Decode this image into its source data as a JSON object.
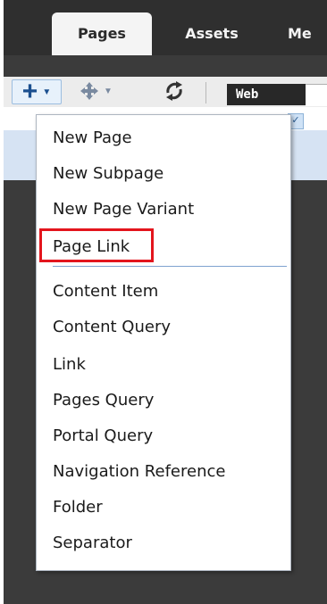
{
  "tabs": {
    "pages": "Pages",
    "assets": "Assets",
    "more": "Me"
  },
  "toolbar": {
    "add_icon": "plus-icon",
    "move_icon": "move-arrows-icon",
    "refresh_icon": "refresh-icon",
    "web_label": "Web"
  },
  "menu": {
    "items": [
      "New Page",
      "New Subpage",
      "New Page Variant",
      "Page Link",
      "Content Item",
      "Content Query",
      "Link",
      "Pages Query",
      "Portal Query",
      "Navigation Reference",
      "Folder",
      "Separator"
    ],
    "highlighted_item": "Page Link"
  },
  "colors": {
    "header_bg": "#2f2f2f",
    "highlight_border": "#e3151d",
    "accent_blue": "#1b4f8f"
  }
}
